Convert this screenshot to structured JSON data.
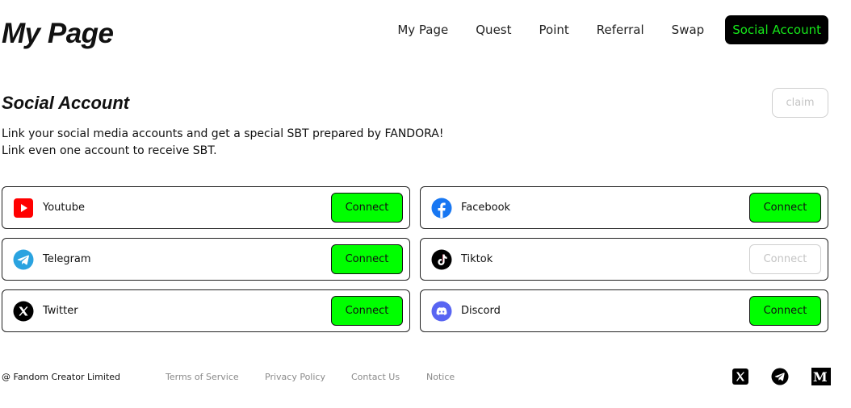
{
  "header": {
    "title": "My Page",
    "nav": [
      "My Page",
      "Quest",
      "Point",
      "Referral",
      "Swap",
      "Social Account"
    ],
    "active_nav": "Social Account"
  },
  "section": {
    "title": "Social Account",
    "claim_label": "claim",
    "description_line1": "Link your social media accounts and get a special SBT prepared by FANDORA!",
    "description_line2": "Link even one account to receive SBT."
  },
  "accounts": [
    {
      "name": "Youtube",
      "icon": "youtube-icon",
      "button": "Connect",
      "enabled": true
    },
    {
      "name": "Facebook",
      "icon": "facebook-icon",
      "button": "Connect",
      "enabled": true
    },
    {
      "name": "Telegram",
      "icon": "telegram-icon",
      "button": "Connect",
      "enabled": true
    },
    {
      "name": "Tiktok",
      "icon": "tiktok-icon",
      "button": "Connect",
      "enabled": false
    },
    {
      "name": "Twitter",
      "icon": "twitter-x-icon",
      "button": "Connect",
      "enabled": true
    },
    {
      "name": "Discord",
      "icon": "discord-icon",
      "button": "Connect",
      "enabled": true
    }
  ],
  "footer": {
    "copyright": "@ Fandom Creator Limited",
    "links": [
      "Terms of Service",
      "Privacy Policy",
      "Contact Us",
      "Notice"
    ],
    "socials": [
      "x-icon",
      "telegram-icon",
      "medium-icon"
    ],
    "medium_glyph": "M"
  },
  "colors": {
    "accent_green": "#00ff00",
    "nav_active_text": "#16e81a",
    "youtube": "#ff0000",
    "facebook": "#1877f2",
    "telegram": "#2aa3e0",
    "discord": "#5865f2"
  }
}
